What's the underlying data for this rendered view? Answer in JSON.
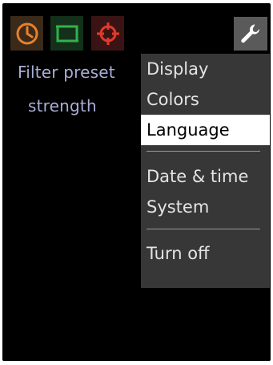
{
  "toolbar": {
    "icons": [
      {
        "name": "clock-icon",
        "color": "#e8802a"
      },
      {
        "name": "frame-icon",
        "color": "#2fb34a"
      },
      {
        "name": "crosshair-icon",
        "color": "#e23a2a"
      }
    ],
    "settings_icon": "wrench-icon"
  },
  "content": {
    "line1": "Filter preset",
    "line2": "strength"
  },
  "menu": {
    "items": [
      {
        "label": "Display",
        "selected": false
      },
      {
        "label": "Colors",
        "selected": false
      },
      {
        "label": "Language",
        "selected": true
      },
      {
        "label": "Date & time",
        "selected": false
      },
      {
        "label": "System",
        "selected": false
      },
      {
        "label": "Turn off",
        "selected": false
      }
    ]
  }
}
